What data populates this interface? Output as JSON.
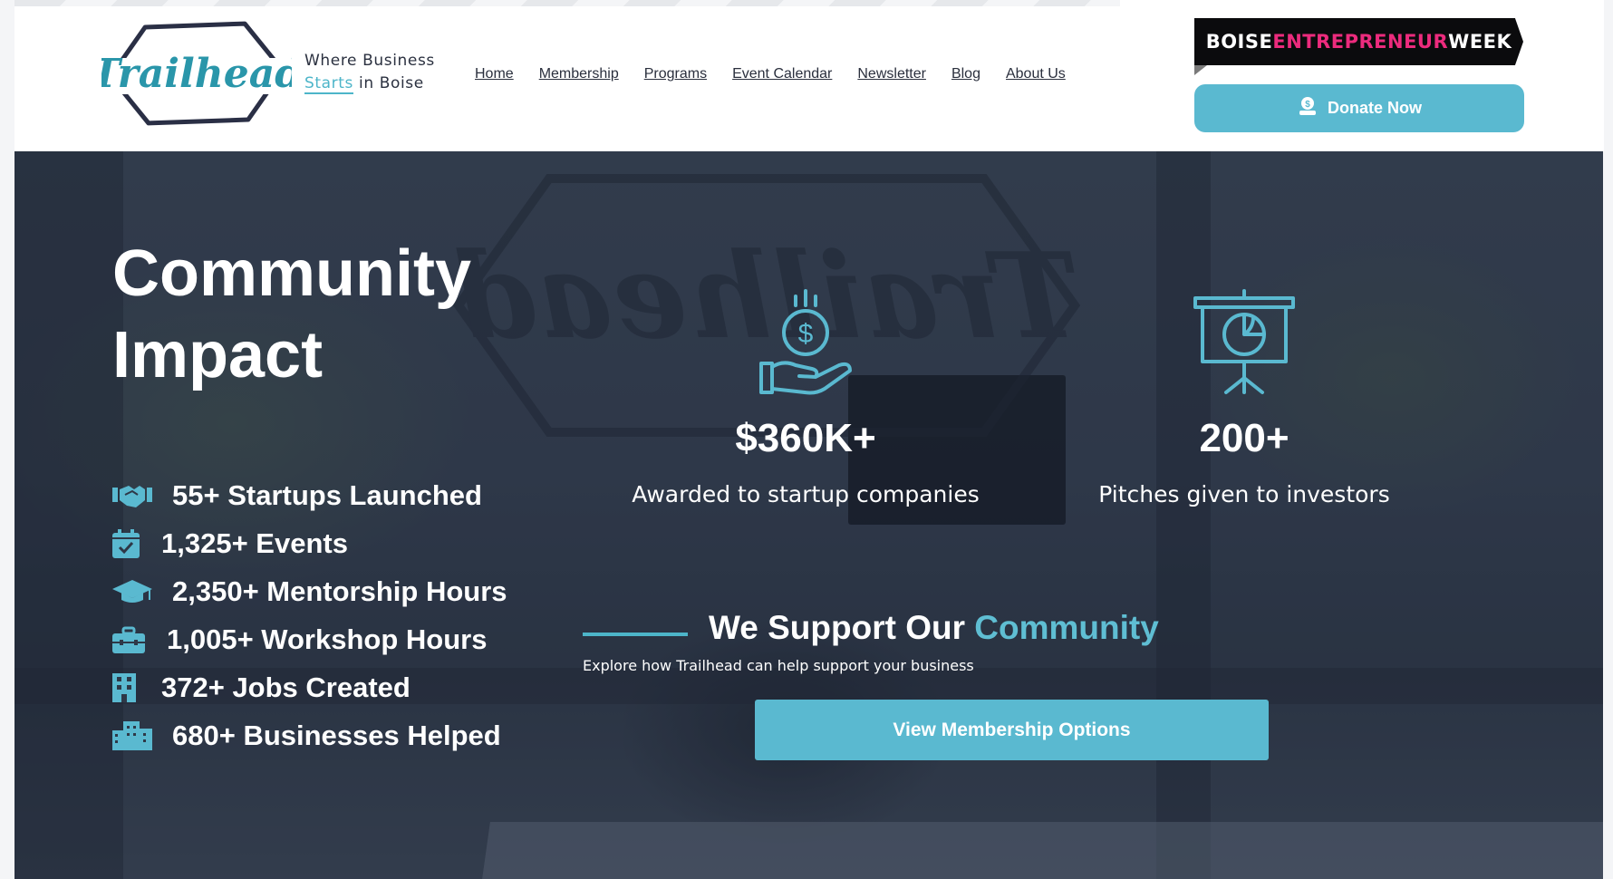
{
  "brand": {
    "logo_text": "Trailhead",
    "tagline_line1": "Where Business",
    "tagline_accent": "Starts",
    "tagline_rest": " in Boise",
    "accent_color": "#4db5c9"
  },
  "nav": {
    "items": [
      {
        "label": "Home"
      },
      {
        "label": "Membership"
      },
      {
        "label": "Programs"
      },
      {
        "label": "Event Calendar"
      },
      {
        "label": "Newsletter"
      },
      {
        "label": "Blog"
      },
      {
        "label": "About Us"
      }
    ]
  },
  "header": {
    "banner": {
      "part1": "BOISE",
      "part2": "ENTREPRENEUR",
      "part3": "WEEK",
      "pink": "#ec2b7d"
    },
    "donate_label": "Donate Now",
    "donate_icon": "hand-coin-icon"
  },
  "hero": {
    "title_line1": "Community",
    "title_line2": "Impact",
    "watermark_text": "Trailhead",
    "stats": [
      {
        "icon": "handshake-icon",
        "text": "55+ Startups Launched"
      },
      {
        "icon": "calendar-check-icon",
        "text": "1,325+ Events"
      },
      {
        "icon": "graduation-cap-icon",
        "text": "2,350+ Mentorship Hours"
      },
      {
        "icon": "toolbox-icon",
        "text": "1,005+ Workshop Hours"
      },
      {
        "icon": "building-icon",
        "text": "372+ Jobs Created"
      },
      {
        "icon": "city-icon",
        "text": "680+ Businesses Helped"
      }
    ],
    "big_stats": [
      {
        "icon": "money-hand-icon",
        "value": "$360K+",
        "caption": "Awarded to startup companies"
      },
      {
        "icon": "presentation-chart-icon",
        "value": "200+",
        "caption": "Pitches given to investors"
      }
    ],
    "support": {
      "heading_main": "We Support Our ",
      "heading_accent": "Community",
      "subtitle": "Explore how Trailhead can help support your business"
    },
    "cta_label": "View Membership Options"
  }
}
